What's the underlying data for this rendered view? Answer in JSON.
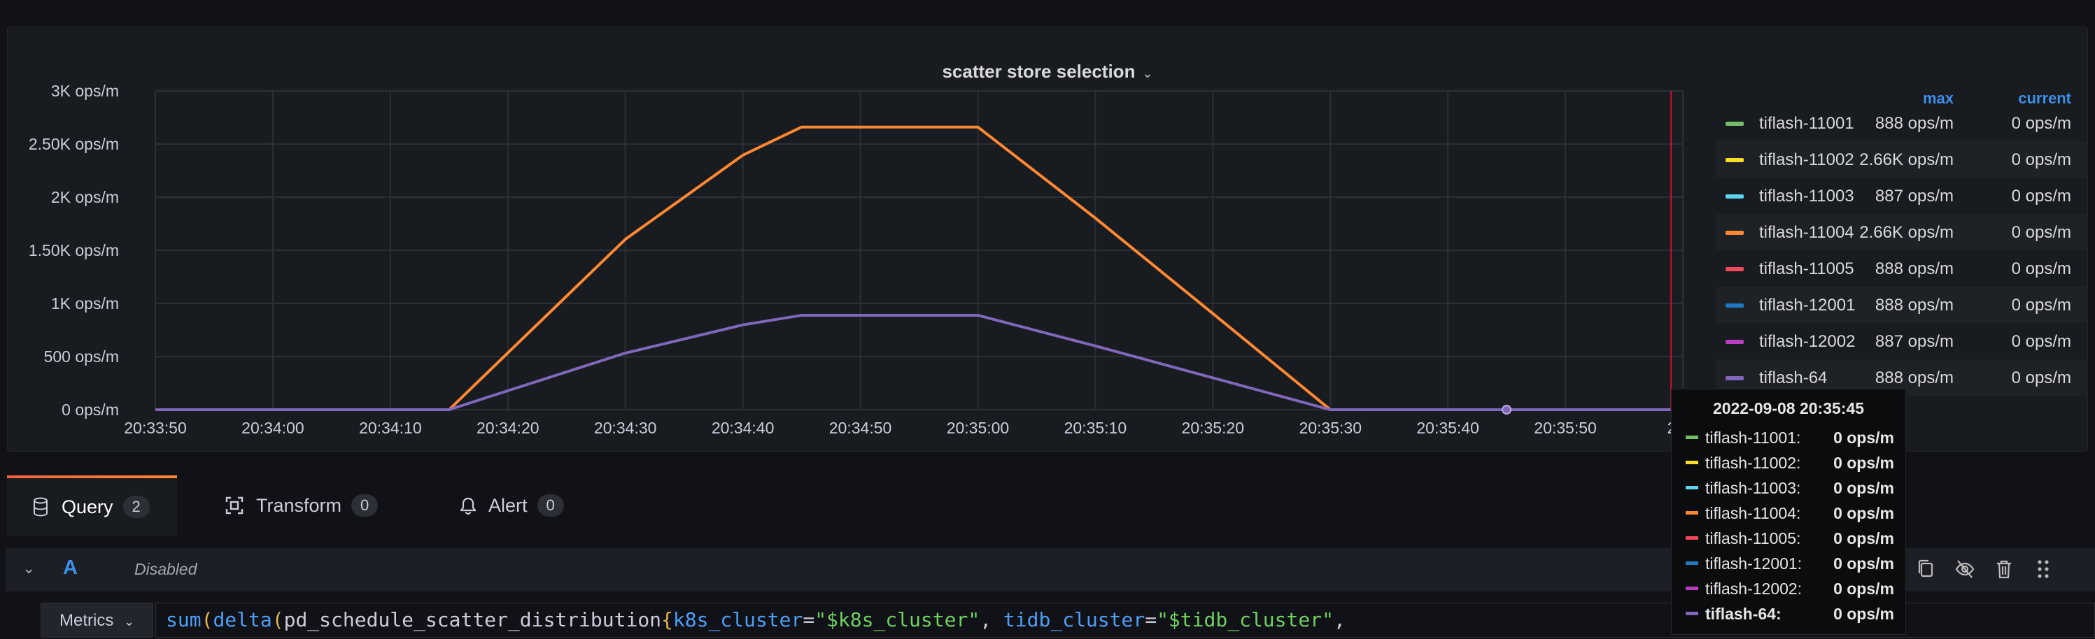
{
  "panel": {
    "title": "scatter store selection",
    "legend": {
      "col_max": "max",
      "col_current": "current",
      "items": [
        {
          "name": "tiflash-11001",
          "max": "888 ops/m",
          "current": "0 ops/m",
          "color": "#73bf69"
        },
        {
          "name": "tiflash-11002",
          "max": "2.66K ops/m",
          "current": "0 ops/m",
          "color": "#fade2a"
        },
        {
          "name": "tiflash-11003",
          "max": "887 ops/m",
          "current": "0 ops/m",
          "color": "#5ed4f0"
        },
        {
          "name": "tiflash-11004",
          "max": "2.66K ops/m",
          "current": "0 ops/m",
          "color": "#ff8833"
        },
        {
          "name": "tiflash-11005",
          "max": "888 ops/m",
          "current": "0 ops/m",
          "color": "#f2495c"
        },
        {
          "name": "tiflash-12001",
          "max": "888 ops/m",
          "current": "0 ops/m",
          "color": "#1f78c1"
        },
        {
          "name": "tiflash-12002",
          "max": "887 ops/m",
          "current": "0 ops/m",
          "color": "#b83dc0"
        },
        {
          "name": "tiflash-64",
          "max": "888 ops/m",
          "current": "0 ops/m",
          "color": "#8067bb"
        }
      ]
    }
  },
  "chart_data": {
    "type": "line",
    "x": [
      "20:33:50",
      "20:34:00",
      "20:34:10",
      "20:34:15",
      "20:34:20",
      "20:34:30",
      "20:34:40",
      "20:34:45",
      "20:34:50",
      "20:35:00",
      "20:35:10",
      "20:35:20",
      "20:35:30",
      "20:35:40",
      "20:35:50",
      "20:36:00"
    ],
    "x_tick_labels": [
      "20:33:50",
      "20:34:00",
      "20:34:10",
      "20:34:20",
      "20:34:30",
      "20:34:40",
      "20:34:50",
      "20:35:00",
      "20:35:10",
      "20:35:20",
      "20:35:30",
      "20:35:40",
      "20:35:50",
      "20:3"
    ],
    "y_tick_labels": [
      "0 ops/m",
      "500 ops/m",
      "1K ops/m",
      "1.50K ops/m",
      "2K ops/m",
      "2.50K ops/m",
      "3K ops/m"
    ],
    "ylim": [
      0,
      3000
    ],
    "grid": true,
    "legend_position": "right",
    "series": [
      {
        "name": "tiflash-11004",
        "color": "#ff8833",
        "values": [
          0,
          0,
          0,
          0,
          535,
          1603,
          2395,
          2660,
          2660,
          2660,
          1803,
          905,
          0,
          0,
          0,
          0
        ]
      },
      {
        "name": "tiflash-64",
        "color": "#8067bb",
        "values": [
          0,
          0,
          0,
          0,
          178,
          533,
          798,
          888,
          888,
          888,
          600,
          300,
          0,
          0,
          0,
          0
        ]
      }
    ],
    "hover": {
      "time": "20:35:45",
      "value": 0
    }
  },
  "tooltip": {
    "title": "2022-09-08 20:35:45",
    "rows": [
      {
        "name": "tiflash-11001:",
        "value": "0 ops/m",
        "color": "#73bf69"
      },
      {
        "name": "tiflash-11002:",
        "value": "0 ops/m",
        "color": "#fade2a"
      },
      {
        "name": "tiflash-11003:",
        "value": "0 ops/m",
        "color": "#5ed4f0"
      },
      {
        "name": "tiflash-11004:",
        "value": "0 ops/m",
        "color": "#ff8833"
      },
      {
        "name": "tiflash-11005:",
        "value": "0 ops/m",
        "color": "#f2495c"
      },
      {
        "name": "tiflash-12001:",
        "value": "0 ops/m",
        "color": "#1f78c1"
      },
      {
        "name": "tiflash-12002:",
        "value": "0 ops/m",
        "color": "#b83dc0"
      },
      {
        "name": "tiflash-64:",
        "value": "0 ops/m",
        "color": "#8067bb"
      }
    ]
  },
  "tabs": [
    {
      "label": "Query",
      "count": "2",
      "icon": "database-icon",
      "active": true
    },
    {
      "label": "Transform",
      "count": "0",
      "icon": "transform-icon",
      "active": false
    },
    {
      "label": "Alert",
      "count": "0",
      "icon": "bell-icon",
      "active": false
    }
  ],
  "query": {
    "letter": "A",
    "status": "Disabled",
    "editor_mode": "Metrics",
    "expr": {
      "fn1": "sum",
      "fn2": "delta",
      "metric": "pd_schedule_scatter_distribution",
      "label1": "k8s_cluster",
      "value1": "\"$k8s_cluster\"",
      "label2": "tidb_cluster",
      "value2": "\"$tidb_cluster\""
    },
    "actions": [
      "copy-icon",
      "eye-slash-icon",
      "trash-icon",
      "drag-handle-icon"
    ]
  },
  "colors": {
    "accent": "#3d8ee8",
    "background": "#111217",
    "panel": "#181b1f"
  }
}
